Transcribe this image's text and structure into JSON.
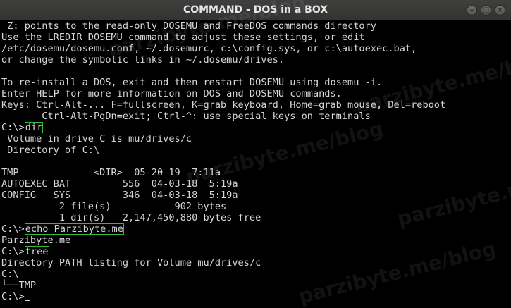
{
  "window": {
    "title": "COMMAND - DOS in a BOX",
    "buttons": {
      "minimize": "–",
      "maximize": "□",
      "close": "×"
    }
  },
  "watermark": "parzibyte.me/blog",
  "terminal": {
    "lines": [
      " Z: points to the read-only DOSEMU and FreeDOS commands directory",
      "Use the LREDIR DOSEMU command to adjust these settings, or edit",
      "/etc/dosemu/dosemu.conf, ~/.dosemurc, c:\\config.sys, or c:\\autoexec.bat,",
      "or change the symbolic links in ~/.dosemu/drives.",
      "",
      "To re-install a DOS, exit and then restart DOSEMU using dosemu -i.",
      "Enter HELP for more information on DOS and DOSEMU commands.",
      "Keys: Ctrl-Alt-... F=fullscreen, K=grab keyboard, Home=grab mouse, Del=reboot",
      "       Ctrl-Alt-PgDn=exit; Ctrl-^: use special keys on terminals"
    ],
    "cmd1": {
      "prompt": "C:\\>",
      "command": "dir"
    },
    "dir_output": [
      " Volume in drive C is mu/drives/c",
      " Directory of C:\\",
      "",
      "TMP             <DIR>  05-20-19  7:11a",
      "AUTOEXEC BAT         556  04-03-18  5:19a",
      "CONFIG   SYS         346  04-03-18  5:19a",
      "          2 file(s)           902 bytes",
      "          1 dir(s)   2,147,450,880 bytes free"
    ],
    "cmd2": {
      "prompt": "C:\\>",
      "command": "echo Parzibyte.me"
    },
    "echo_output": "Parzibyte.me",
    "cmd3": {
      "prompt": "C:\\>",
      "command": "tree"
    },
    "tree_output": [
      "Directory PATH listing for Volume mu/drives/c",
      "C:\\",
      "└──TMP"
    ],
    "final_prompt": "C:\\>"
  }
}
